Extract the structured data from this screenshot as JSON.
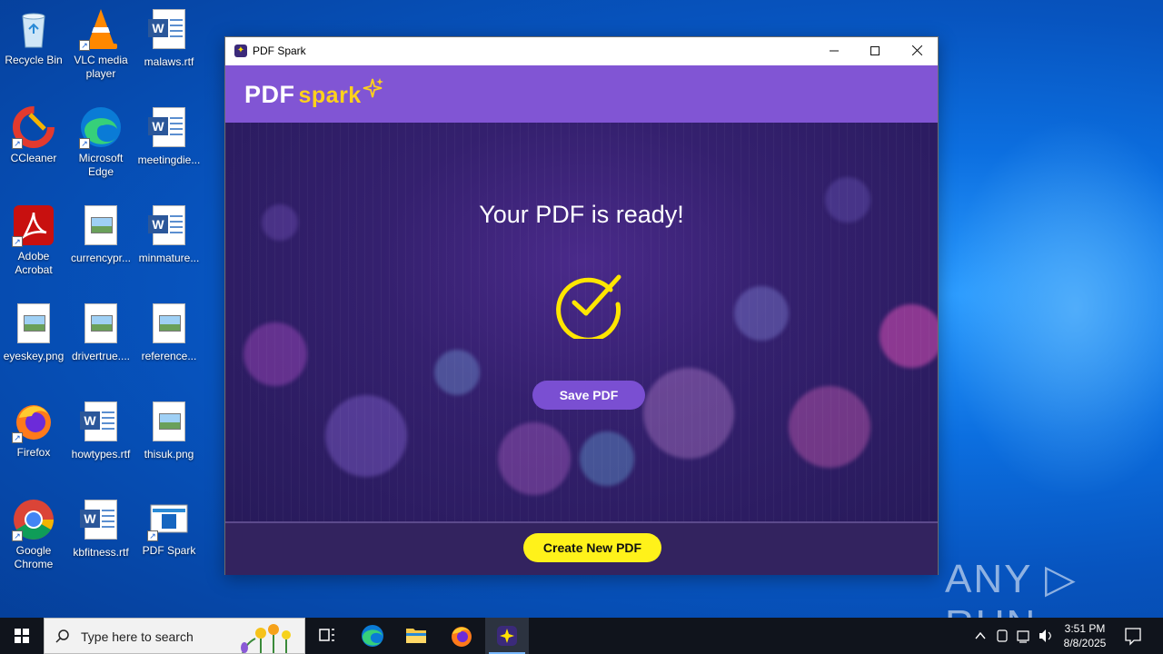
{
  "desktop": {
    "icons": [
      {
        "label": "Recycle Bin"
      },
      {
        "label": "VLC media player"
      },
      {
        "label": "malaws.rtf"
      },
      {
        "label": "CCleaner"
      },
      {
        "label": "Microsoft Edge"
      },
      {
        "label": "meetingdie..."
      },
      {
        "label": "Adobe Acrobat"
      },
      {
        "label": "currencypr..."
      },
      {
        "label": "minmature..."
      },
      {
        "label": "eyeskey.png"
      },
      {
        "label": "drivertrue...."
      },
      {
        "label": "reference..."
      },
      {
        "label": "Firefox"
      },
      {
        "label": "howtypes.rtf"
      },
      {
        "label": "thisuk.png"
      },
      {
        "label": "Google Chrome"
      },
      {
        "label": "kbfitness.rtf"
      },
      {
        "label": "PDF Spark"
      }
    ]
  },
  "window": {
    "title": "PDF Spark",
    "logo_pdf": "PDF",
    "logo_spark": "spark",
    "heading": "Your PDF is ready!",
    "save_button": "Save PDF",
    "create_button": "Create New PDF"
  },
  "watermark": "ANY ▷ RUN",
  "taskbar": {
    "search_placeholder": "Type here to search",
    "time": "3:51 PM",
    "date": "8/8/2025"
  },
  "colors": {
    "header_purple": "#8155d4",
    "save_button": "#7a4fd2",
    "create_button": "#fff21a",
    "check_yellow": "#ffe600"
  }
}
